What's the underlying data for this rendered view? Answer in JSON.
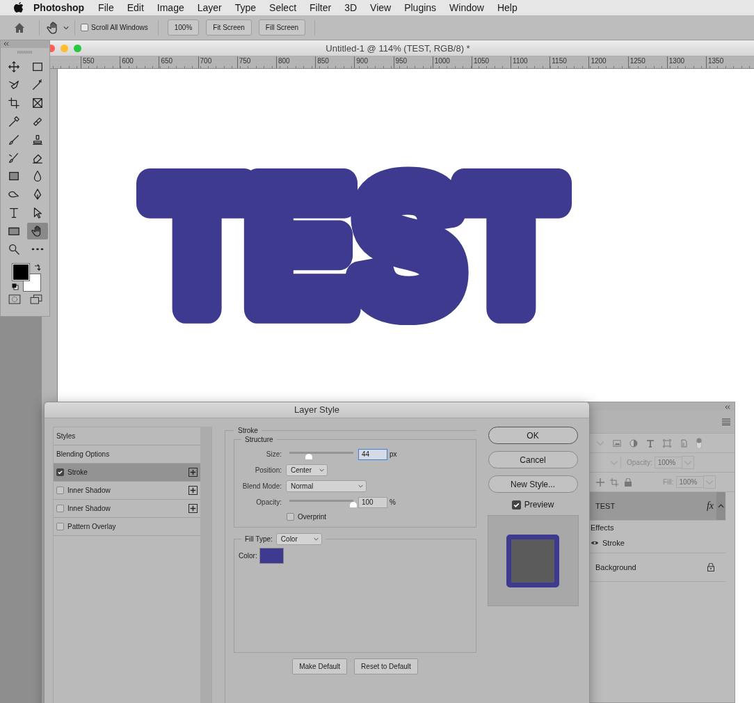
{
  "menubar": {
    "app": "Photoshop",
    "items": [
      "File",
      "Edit",
      "Image",
      "Layer",
      "Type",
      "Select",
      "Filter",
      "3D",
      "View",
      "Plugins",
      "Window",
      "Help"
    ]
  },
  "options_bar": {
    "scroll_all": {
      "label": "Scroll All Windows",
      "checked": false
    },
    "buttons": [
      "100%",
      "Fit Screen",
      "Fill Screen"
    ]
  },
  "document": {
    "title": "Untitled-1 @ 114% (TEST, RGB/8) *",
    "ruler": [
      "550",
      "600",
      "650",
      "700",
      "750",
      "800",
      "850",
      "900",
      "950",
      "1000",
      "1050",
      "1100",
      "1150",
      "1200",
      "1250",
      "1300",
      "1350"
    ],
    "canvas_text": "TEST"
  },
  "tools": [
    {
      "selected": false
    },
    {
      "selected": false
    },
    {
      "selected": false
    },
    {
      "selected": false
    },
    {
      "selected": false
    },
    {
      "selected": false
    },
    {
      "selected": false
    },
    {
      "selected": false
    },
    {
      "selected": false
    },
    {
      "selected": false
    },
    {
      "selected": false
    },
    {
      "selected": false
    },
    {
      "selected": false
    },
    {
      "selected": false
    },
    {
      "selected": false
    },
    {
      "selected": false
    },
    {
      "selected": false
    },
    {
      "selected": false
    },
    {
      "selected": false
    },
    {
      "selected": true
    },
    {
      "selected": false
    },
    {
      "selected": false
    }
  ],
  "dialog": {
    "title": "Layer Style",
    "styles": [
      {
        "kind": "header",
        "label": "Styles",
        "selected": false
      },
      {
        "kind": "header",
        "label": "Blending Options",
        "selected": false
      },
      {
        "kind": "effect",
        "label": "Stroke",
        "checked": true,
        "selected": true,
        "addable": true
      },
      {
        "kind": "effect",
        "label": "Inner Shadow",
        "checked": false,
        "selected": false,
        "addable": true
      },
      {
        "kind": "effect",
        "label": "Inner Shadow",
        "checked": false,
        "selected": false,
        "addable": true
      },
      {
        "kind": "effect",
        "label": "Pattern Overlay",
        "checked": false,
        "selected": false,
        "addable": false
      }
    ],
    "section": "Stroke",
    "group": "Structure",
    "size": {
      "label": "Size:",
      "level": 0.3,
      "value": "44",
      "unit": "px"
    },
    "position": {
      "label": "Position:",
      "value": "Center"
    },
    "blend_mode": {
      "label": "Blend Mode:",
      "value": "Normal"
    },
    "opacity": {
      "label": "Opacity:",
      "level": 1.0,
      "value": "100",
      "unit": "%"
    },
    "overprint": {
      "label": "Overprint",
      "checked": false
    },
    "fill_type": {
      "label": "Fill Type:",
      "value": "Color"
    },
    "color": {
      "label": "Color:",
      "color": "#3d3a8f"
    },
    "bottom_buttons": [
      "Make Default",
      "Reset to Default"
    ],
    "buttons": [
      "OK",
      "Cancel",
      "New Style..."
    ],
    "preview": {
      "label": "Preview",
      "checked": true
    }
  },
  "layers_panel": {
    "disabled": true,
    "opacity": {
      "label": "Opacity:",
      "value": "100%"
    },
    "fill": {
      "label": "Fill:",
      "value": "100%"
    },
    "layers": [
      {
        "name": "TEST",
        "selected": true,
        "fx": "fx",
        "effects_label": "Effects",
        "effects": [
          "Stroke"
        ]
      },
      {
        "name": "Background",
        "selected": false,
        "locked": true
      }
    ]
  }
}
